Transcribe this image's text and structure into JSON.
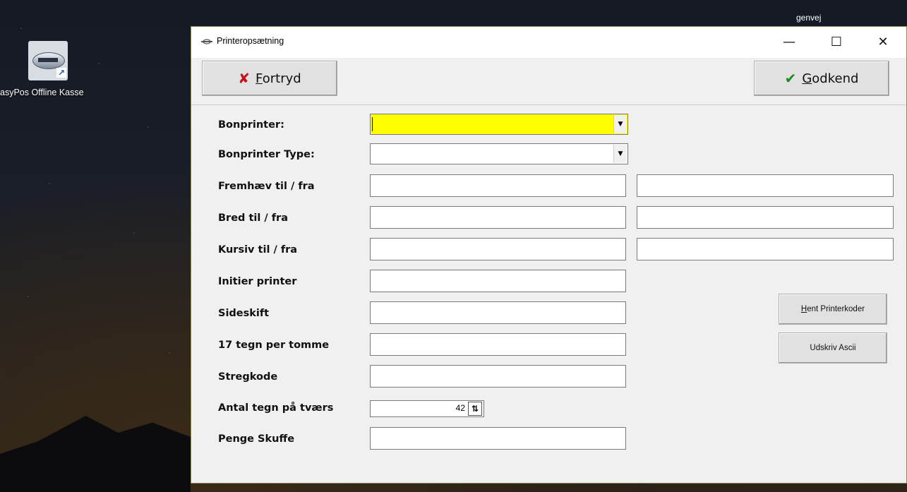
{
  "desktop": {
    "icon_label": "asyPos Offline Kasse",
    "top_right_label": "genvej"
  },
  "window": {
    "title": "Printeropsætning",
    "controls": {
      "minimize": "—",
      "maximize": "☐",
      "close": "✕"
    }
  },
  "toolbar": {
    "cancel": {
      "underlined": "F",
      "rest": "ortryd",
      "icon": "x-icon"
    },
    "approve": {
      "underlined": "G",
      "rest": "odkend",
      "icon": "check-icon"
    }
  },
  "form": {
    "labels": {
      "bonprinter": "Bonprinter:",
      "bonprinter_type": "Bonprinter Type:",
      "fremhaev": "Fremhæv til / fra",
      "bred": "Bred til / fra",
      "kursiv": "Kursiv til / fra",
      "initier": "Initier printer",
      "sideskift": "Sideskift",
      "tegn17": "17 tegn per tomme",
      "stregkode": "Stregkode",
      "antal": "Antal tegn på tværs",
      "penge": "Penge Skuffe"
    },
    "values": {
      "bonprinter": "",
      "bonprinter_type": "",
      "fremhaev_til": "",
      "fremhaev_fra": "",
      "bred_til": "",
      "bred_fra": "",
      "kursiv_til": "",
      "kursiv_fra": "",
      "initier": "",
      "sideskift": "",
      "tegn17": "",
      "stregkode": "",
      "antal": "42",
      "penge": ""
    },
    "highlight_color": "#ffff00"
  },
  "buttons": {
    "hent": {
      "underlined": "H",
      "rest": "ent Printerkoder"
    },
    "udskriv": "Udskriv Ascii"
  }
}
